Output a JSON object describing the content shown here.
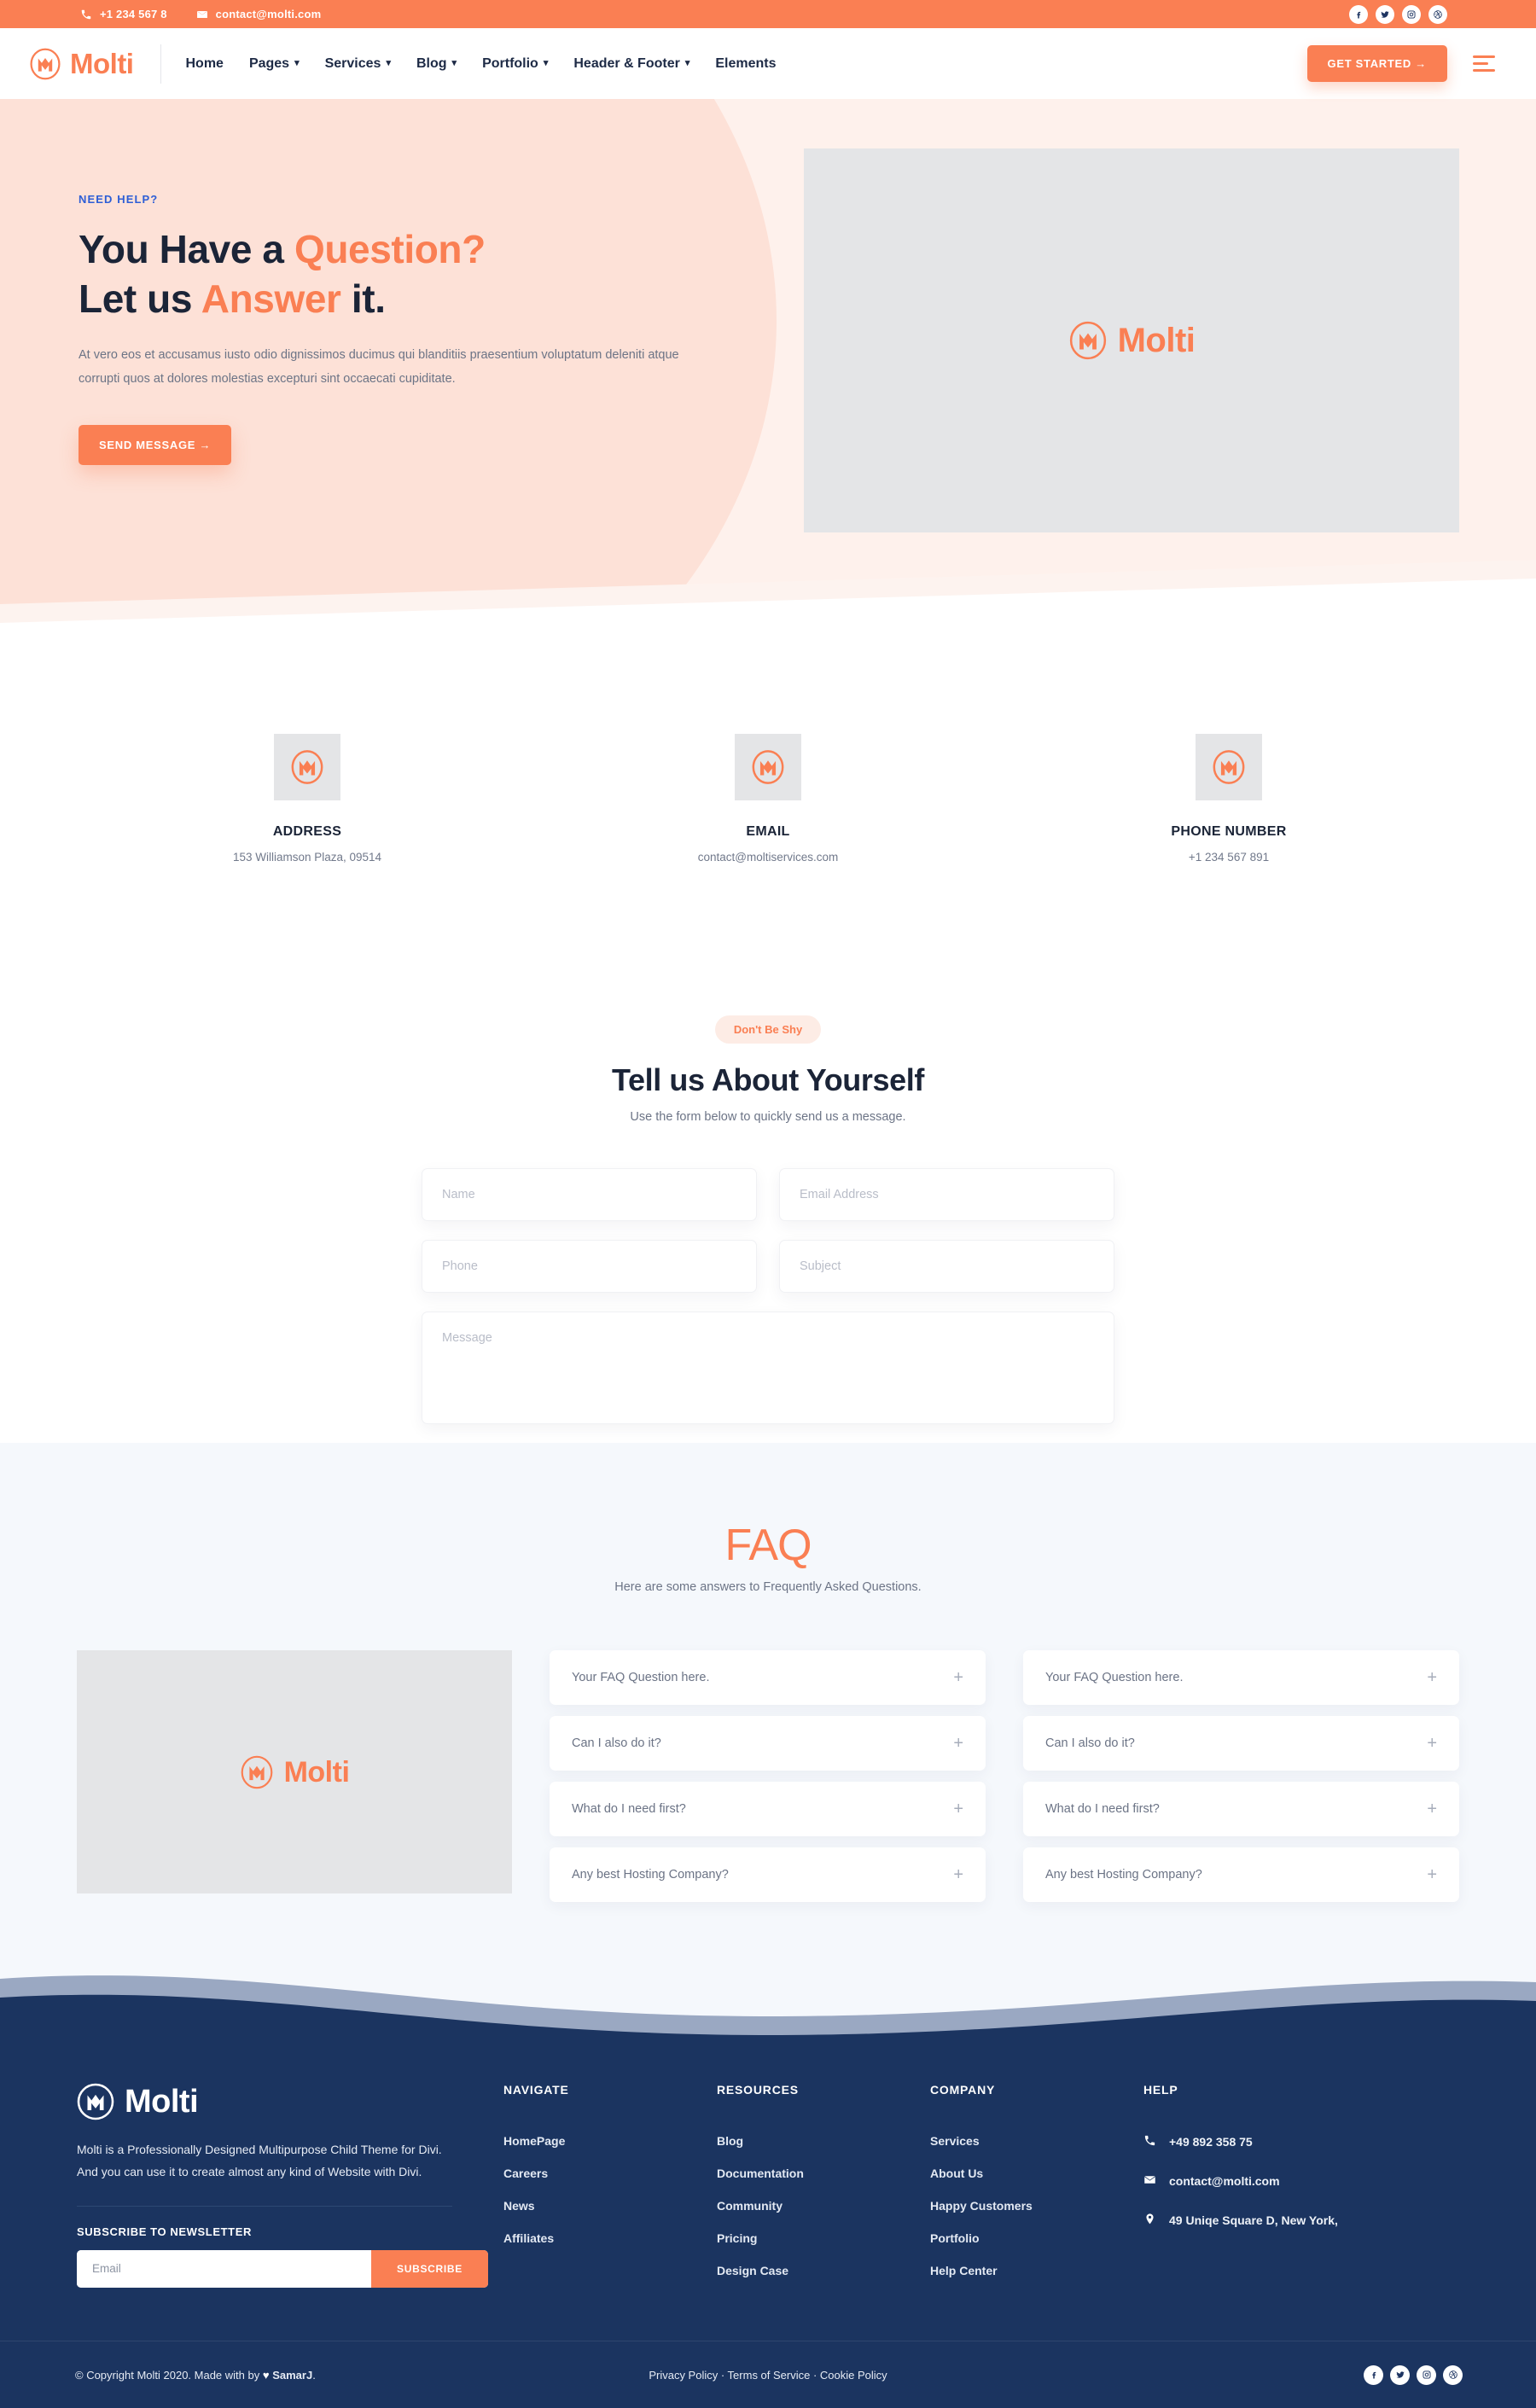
{
  "topbar": {
    "phone": "+1 234 567 8",
    "email": "contact@molti.com",
    "phone_icon": "phone-icon",
    "email_icon": "envelope-icon",
    "socials": [
      "facebook-icon",
      "twitter-icon",
      "instagram-icon",
      "dribbble-icon"
    ]
  },
  "nav": {
    "brand": "Molti",
    "items": [
      {
        "label": "Home",
        "caret": false
      },
      {
        "label": "Pages",
        "caret": true
      },
      {
        "label": "Services",
        "caret": true
      },
      {
        "label": "Blog",
        "caret": true
      },
      {
        "label": "Portfolio",
        "caret": true
      },
      {
        "label": "Header & Footer",
        "caret": true
      },
      {
        "label": "Elements",
        "caret": false
      }
    ],
    "cta": "GET STARTED  →",
    "menu_icon": "hamburger-icon"
  },
  "hero": {
    "eyebrow": "NEED HELP?",
    "title_1a": "You Have a ",
    "title_1b": "Question?",
    "title_2a": "Let us ",
    "title_2b": "Answer",
    "title_2c": " it.",
    "paragraph": "At vero eos et accusamus iusto odio dignissimos ducimus qui blanditiis praesentium voluptatum deleniti atque corrupti quos at dolores molestias excepturi sint occaecati cupiditate.",
    "cta": "SEND MESSAGE  →",
    "image_logo": "Molti"
  },
  "contact_cards": [
    {
      "title": "ADDRESS",
      "value": "153 Williamson Plaza, 09514",
      "icon": "molti-logo-icon"
    },
    {
      "title": "EMAIL",
      "value": "contact@moltiservices.com",
      "icon": "molti-logo-icon"
    },
    {
      "title": "PHONE NUMBER",
      "value": "+1 234 567 891",
      "icon": "molti-logo-icon"
    }
  ],
  "form": {
    "badge": "Don't Be Shy",
    "heading": "Tell us About Yourself",
    "subheading": "Use the form below to quickly send us a message.",
    "fields": {
      "name": "Name",
      "email": "Email Address",
      "phone": "Phone",
      "subject": "Subject",
      "message": "Message"
    }
  },
  "faq": {
    "heading": "FAQ",
    "subheading": "Here are some answers to Frequently Asked Questions.",
    "image_logo": "Molti",
    "left": [
      "Your FAQ Question here.",
      "Can I also do it?",
      "What do I need first?",
      "Any best Hosting Company?"
    ],
    "right": [
      "Your FAQ Question here.",
      "Can I also do it?",
      "What do I need first?",
      "Any best Hosting Company?"
    ],
    "expand_icon": "plus-icon"
  },
  "footer": {
    "brand": "Molti",
    "description": "Molti is a Professionally Designed  Multipurpose Child Theme for Divi. And you can use it to create almost any kind of Website with Divi.",
    "newsletter_title": "SUBSCRIBE TO NEWSLETTER",
    "newsletter_placeholder": "Email",
    "newsletter_button": "SUBSCRIBE",
    "columns": [
      {
        "title": "NAVIGATE",
        "links": [
          "HomePage",
          "Careers",
          "News",
          "Affiliates"
        ]
      },
      {
        "title": "RESOURCES",
        "links": [
          "Blog",
          "Documentation",
          "Community",
          "Pricing",
          "Design Case"
        ]
      },
      {
        "title": "COMPANY",
        "links": [
          "Services",
          "About Us",
          "Happy Customers",
          "Portfolio",
          "Help Center"
        ]
      }
    ],
    "help": {
      "title": "HELP",
      "rows": [
        {
          "icon": "phone-icon",
          "text": "+49 892 358 75"
        },
        {
          "icon": "envelope-icon",
          "text": "contact@molti.com"
        },
        {
          "icon": "location-pin-icon",
          "text": "49 Uniqe Square D, New York,"
        }
      ]
    },
    "bottom": {
      "copyright_pre": "© Copyright Molti 2020. Made with by ",
      "heart": "♥",
      "author": "SamarJ",
      "copyright_post": ".",
      "legal": [
        "Privacy Policy",
        "Terms of Service",
        "Cookie Policy"
      ],
      "legal_joined": "Privacy Policy · Terms of Service · Cookie Policy",
      "socials": [
        "facebook-icon",
        "twitter-icon",
        "instagram-icon",
        "dribbble-icon"
      ]
    }
  },
  "colors": {
    "accent": "#fa7f53",
    "navy": "#1b3460",
    "hero_bg": "#fef1ec",
    "faq_bg": "#f5f8fc",
    "eyebrow": "#2d5ed6"
  }
}
